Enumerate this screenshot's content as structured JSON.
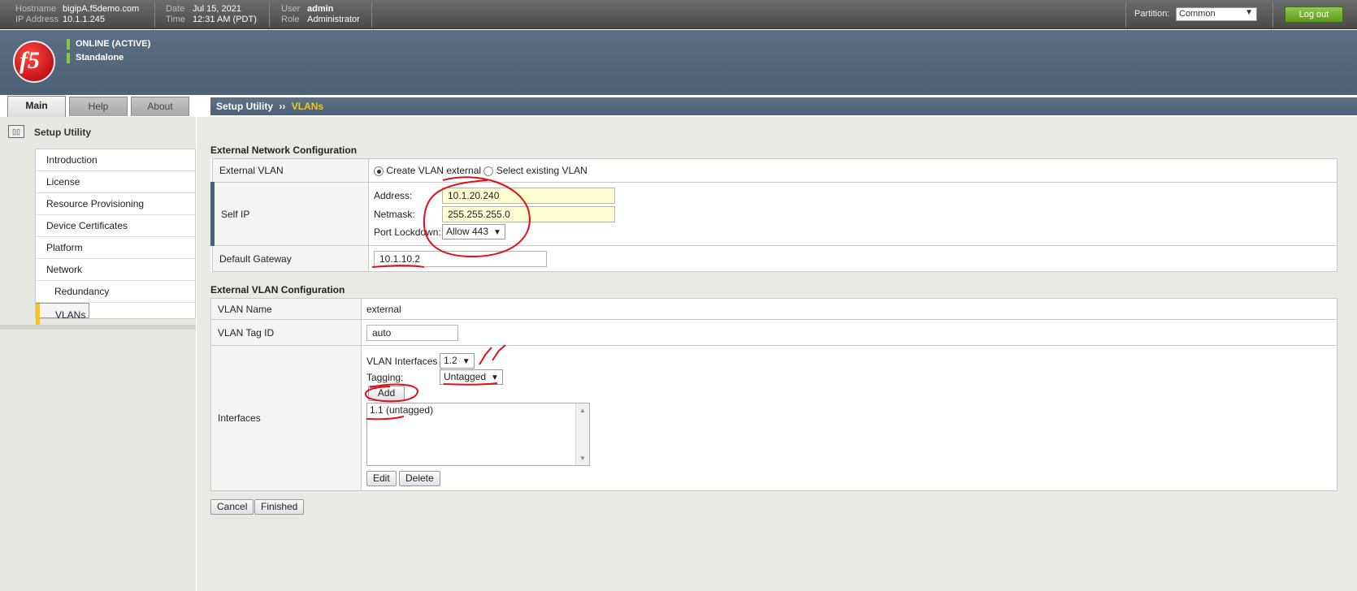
{
  "topbar": {
    "hostname_label": "Hostname",
    "hostname": "bigipA.f5demo.com",
    "ip_label": "IP Address",
    "ip": "10.1.1.245",
    "date_label": "Date",
    "date": "Jul 15, 2021",
    "time_label": "Time",
    "time": "12:31 AM (PDT)",
    "user_label": "User",
    "user": "admin",
    "role_label": "Role",
    "role": "Administrator",
    "partition_label": "Partition:",
    "partition_value": "Common",
    "logout_label": "Log out"
  },
  "header": {
    "logo_text": "f5",
    "status_online": "ONLINE (ACTIVE)",
    "status_mode": "Standalone"
  },
  "tabs": {
    "main": "Main",
    "help": "Help",
    "about": "About"
  },
  "breadcrumb": {
    "parent": "Setup Utility",
    "sep": "››",
    "current": "VLANs"
  },
  "sidebar": {
    "title": "Setup Utility",
    "items": [
      {
        "label": "Introduction"
      },
      {
        "label": "License"
      },
      {
        "label": "Resource Provisioning"
      },
      {
        "label": "Device Certificates"
      },
      {
        "label": "Platform"
      },
      {
        "label": "Network"
      },
      {
        "label": "Redundancy"
      },
      {
        "label": "VLANs"
      }
    ]
  },
  "external_network": {
    "section_title": "External Network Configuration",
    "external_vlan_label": "External VLAN",
    "create_option": "Create VLAN external",
    "select_option": "Select existing VLAN",
    "self_ip_label": "Self IP",
    "address_label": "Address:",
    "address_value": "10.1.20.240",
    "netmask_label": "Netmask:",
    "netmask_value": "255.255.255.0",
    "port_lockdown_label": "Port Lockdown:",
    "port_lockdown_value": "Allow 443",
    "gateway_label": "Default Gateway",
    "gateway_value": "10.1.10.2"
  },
  "external_vlan": {
    "section_title": "External VLAN Configuration",
    "vlan_name_label": "VLAN Name",
    "vlan_name_value": "external",
    "vlan_tag_label": "VLAN Tag ID",
    "vlan_tag_value": "auto",
    "interfaces_label": "Interfaces",
    "vlan_interfaces_label": "VLAN Interfaces",
    "vlan_interfaces_value": "1.2",
    "tagging_label": "Tagging:",
    "tagging_value": "Untagged",
    "add_button": "Add",
    "interface_list": [
      "1.1 (untagged)"
    ],
    "edit_button": "Edit",
    "delete_button": "Delete"
  },
  "footer_buttons": {
    "cancel": "Cancel",
    "finished": "Finished"
  },
  "colors": {
    "accent": "#f5c518",
    "status_green": "#8cc63f",
    "annotation_red": "#e0101a"
  },
  "icons": {
    "dropdown": "▼",
    "scroll_up": "▲",
    "scroll_down": "▼"
  }
}
